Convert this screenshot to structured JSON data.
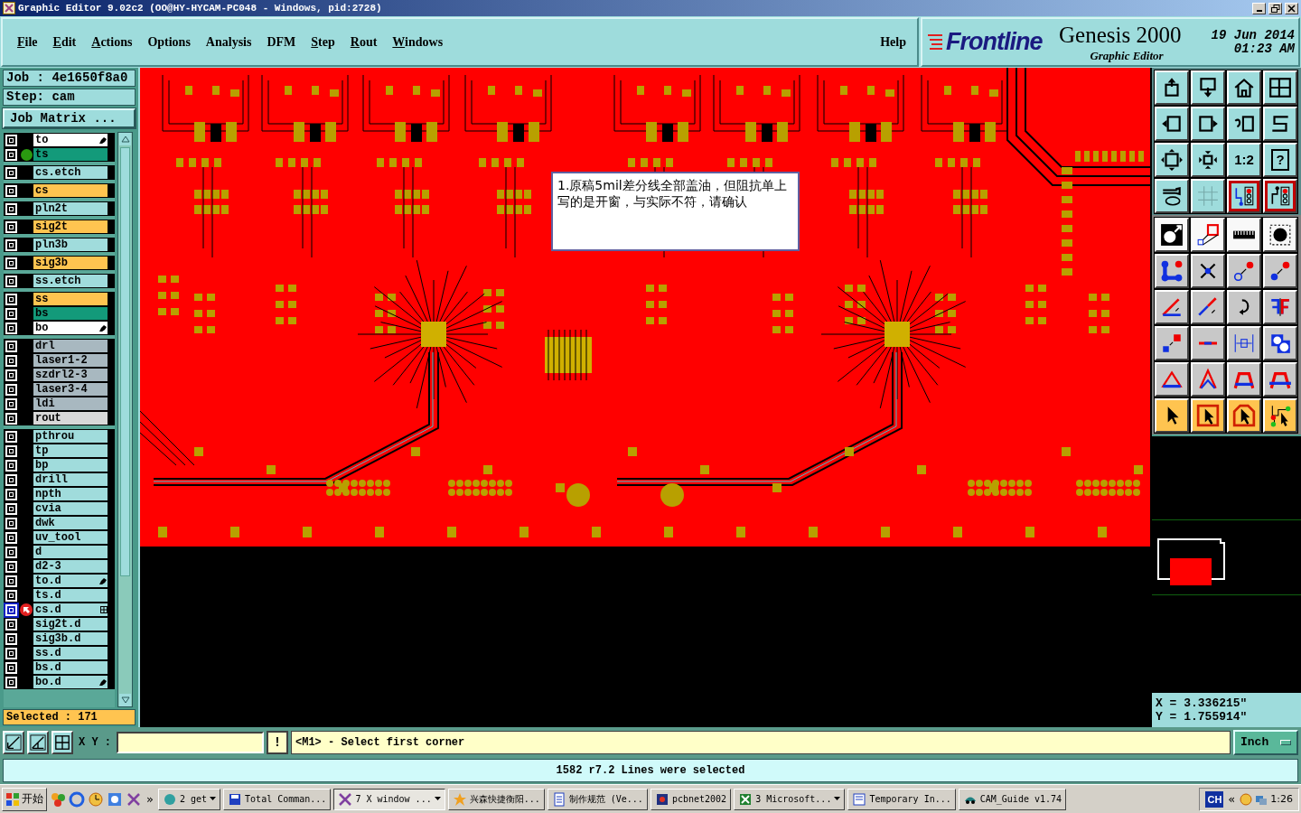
{
  "window": {
    "title": "Graphic Editor 9.02c2 (OO@HY-HYCAM-PC048 - Windows, pid:2728)"
  },
  "menu": [
    {
      "label": "File",
      "mnemonic": true
    },
    {
      "label": "Edit",
      "mnemonic": true
    },
    {
      "label": "Actions",
      "mnemonic": true
    },
    {
      "label": "Options",
      "mnemonic": false
    },
    {
      "label": "Analysis",
      "mnemonic": false
    },
    {
      "label": "DFM",
      "mnemonic": false
    },
    {
      "label": "Step",
      "mnemonic": true
    },
    {
      "label": "Rout",
      "mnemonic": true
    },
    {
      "label": "Windows",
      "mnemonic": true
    },
    {
      "label": "Help",
      "mnemonic": false
    }
  ],
  "brand": {
    "logo": "Frontline",
    "product": "Genesis 2000",
    "subtitle": "Graphic Editor",
    "date": "19 Jun 2014",
    "time": "01:23 AM"
  },
  "job": "Job : 4e1650f8a0",
  "step": "Step: cam",
  "matrix_button": "Job Matrix ...",
  "layer_groups": [
    [
      {
        "name": "to",
        "color": "#ffffff",
        "hand": true,
        "dot": false,
        "work": false
      },
      {
        "name": "ts",
        "color": "#139a7a",
        "dot": true,
        "work": false
      }
    ],
    [
      {
        "name": "cs.etch",
        "color": "#a0dcdc",
        "dot": false,
        "work": false
      }
    ],
    [
      {
        "name": "cs",
        "color": "#ffc450",
        "dot": false,
        "work": false
      }
    ],
    [
      {
        "name": "pln2t",
        "color": "#a0dcdc",
        "dot": false,
        "work": false
      }
    ],
    [
      {
        "name": "sig2t",
        "color": "#ffc450",
        "dot": false,
        "work": false
      }
    ],
    [
      {
        "name": "pln3b",
        "color": "#a0dcdc",
        "dot": false,
        "work": false
      }
    ],
    [
      {
        "name": "sig3b",
        "color": "#ffc450",
        "dot": false,
        "work": false
      }
    ],
    [
      {
        "name": "ss.etch",
        "color": "#a0dcdc",
        "dot": false,
        "work": false
      }
    ],
    [
      {
        "name": "ss",
        "color": "#ffc450",
        "dot": false,
        "work": false
      },
      {
        "name": "bs",
        "color": "#139a7a",
        "dot": false,
        "work": false
      },
      {
        "name": "bo",
        "color": "#ffffff",
        "hand": true,
        "dot": false,
        "work": false
      }
    ],
    [
      {
        "name": "drl",
        "color": "#a8b8c0",
        "dot": false,
        "work": false
      },
      {
        "name": "laser1-2",
        "color": "#a8b8c0",
        "dot": false,
        "work": false
      },
      {
        "name": "szdrl2-3",
        "color": "#a8b8c0",
        "dot": false,
        "work": false
      },
      {
        "name": "laser3-4",
        "color": "#a8b8c0",
        "dot": false,
        "work": false
      },
      {
        "name": "ldi",
        "color": "#a8b8c0",
        "dot": false,
        "work": false
      },
      {
        "name": "rout",
        "color": "#d8d8d8",
        "dot": false,
        "work": false
      }
    ],
    [
      {
        "name": "pthrou",
        "color": "#a0dcdc",
        "dot": false,
        "work": false
      },
      {
        "name": "tp",
        "color": "#a0dcdc",
        "dot": false,
        "work": false
      },
      {
        "name": "bp",
        "color": "#a0dcdc",
        "dot": false,
        "work": false
      },
      {
        "name": "drill",
        "color": "#a0dcdc",
        "dot": false,
        "work": false
      },
      {
        "name": "npth",
        "color": "#a0dcdc",
        "dot": false,
        "work": false
      },
      {
        "name": "cvia",
        "color": "#a0dcdc",
        "dot": false,
        "work": false
      },
      {
        "name": "dwk",
        "color": "#a0dcdc",
        "dot": false,
        "work": false
      },
      {
        "name": "uv_tool",
        "color": "#a0dcdc",
        "dot": false,
        "work": false
      },
      {
        "name": "d",
        "color": "#a0dcdc",
        "dot": false,
        "work": false
      },
      {
        "name": "d2-3",
        "color": "#a0dcdc",
        "dot": false,
        "work": false
      },
      {
        "name": "to.d",
        "color": "#a0dcdc",
        "hand": true,
        "dot": false,
        "work": false
      },
      {
        "name": "ts.d",
        "color": "#a0dcdc",
        "dot": false,
        "work": false
      },
      {
        "name": "cs.d",
        "color": "#a0dcdc",
        "grid": true,
        "dot": false,
        "work": true
      },
      {
        "name": "sig2t.d",
        "color": "#a0dcdc",
        "dot": false,
        "work": false
      },
      {
        "name": "sig3b.d",
        "color": "#a0dcdc",
        "dot": false,
        "work": false
      },
      {
        "name": "ss.d",
        "color": "#a0dcdc",
        "dot": false,
        "work": false
      },
      {
        "name": "bs.d",
        "color": "#a0dcdc",
        "dot": false,
        "work": false
      },
      {
        "name": "bo.d",
        "color": "#a0dcdc",
        "hand": true,
        "dot": false,
        "work": false
      }
    ]
  ],
  "selected_count": "Selected : 171",
  "canvas": {
    "note": "1.原稿5mil差分线全部盖油，但阻抗单上写的是开窗，与实际不符，请确认"
  },
  "tools": [
    {
      "kind": "view",
      "on": false
    },
    {
      "kind": "view",
      "on": false
    },
    {
      "kind": "view",
      "on": false
    },
    {
      "kind": "view",
      "on": false
    },
    {
      "kind": "view",
      "on": false
    },
    {
      "kind": "view",
      "on": false
    },
    {
      "kind": "view",
      "on": false
    },
    {
      "kind": "view",
      "on": false
    },
    {
      "kind": "view",
      "on": false
    },
    {
      "kind": "view",
      "on": false
    },
    {
      "kind": "view",
      "on": false,
      "label": "1:2"
    },
    {
      "kind": "view",
      "on": false,
      "label": "?"
    },
    {
      "kind": "view",
      "on": false
    },
    {
      "kind": "view",
      "on": false
    },
    {
      "kind": "view",
      "on": true
    },
    {
      "kind": "view",
      "on": true
    },
    {
      "kind": "shape",
      "on": false
    },
    {
      "kind": "shape",
      "on": false
    },
    {
      "kind": "shape",
      "on": false
    },
    {
      "kind": "shape",
      "on": false
    },
    {
      "kind": "edit",
      "on": false
    },
    {
      "kind": "edit",
      "on": false
    },
    {
      "kind": "edit",
      "on": false
    },
    {
      "kind": "edit",
      "on": false
    },
    {
      "kind": "edit",
      "on": false
    },
    {
      "kind": "edit",
      "on": false
    },
    {
      "kind": "edit",
      "on": false
    },
    {
      "kind": "edit",
      "on": false
    },
    {
      "kind": "edit",
      "on": false
    },
    {
      "kind": "edit",
      "on": false
    },
    {
      "kind": "edit",
      "on": false
    },
    {
      "kind": "edit",
      "on": false
    },
    {
      "kind": "edit",
      "on": false
    },
    {
      "kind": "edit",
      "on": false
    },
    {
      "kind": "edit",
      "on": false
    },
    {
      "kind": "edit",
      "on": false
    },
    {
      "kind": "select",
      "on": false
    },
    {
      "kind": "select",
      "on": false
    },
    {
      "kind": "select",
      "on": false
    },
    {
      "kind": "select",
      "on": false
    }
  ],
  "coordinates": {
    "x": "X = 3.336215\"",
    "y": "Y = 1.755914\""
  },
  "command_bar": {
    "label": "X Y :",
    "alert": "!",
    "prompt": "<M1> - Select first corner",
    "units": "Inch"
  },
  "status": "1582 r7.2 Lines were selected",
  "taskbar": {
    "start": "开始",
    "tasks": [
      {
        "label": "2 get",
        "selected": false,
        "grouped": true
      },
      {
        "label": "Total Comman...",
        "selected": false,
        "grouped": false
      },
      {
        "label": "7 X window ...",
        "selected": true,
        "grouped": true
      },
      {
        "label": "兴森快捷衡阳...",
        "selected": false,
        "grouped": false
      },
      {
        "label": "制作规范 (Ve...",
        "selected": false,
        "grouped": false
      },
      {
        "label": "pcbnet2002",
        "selected": false,
        "grouped": false
      },
      {
        "label": "3 Microsoft...",
        "selected": false,
        "grouped": true
      },
      {
        "label": "Temporary In...",
        "selected": false,
        "grouped": false
      },
      {
        "label": "CAM_Guide v1.74",
        "selected": false,
        "grouped": false
      }
    ],
    "more": "»",
    "language": "CH",
    "expand": "«",
    "clock": "1:26"
  }
}
